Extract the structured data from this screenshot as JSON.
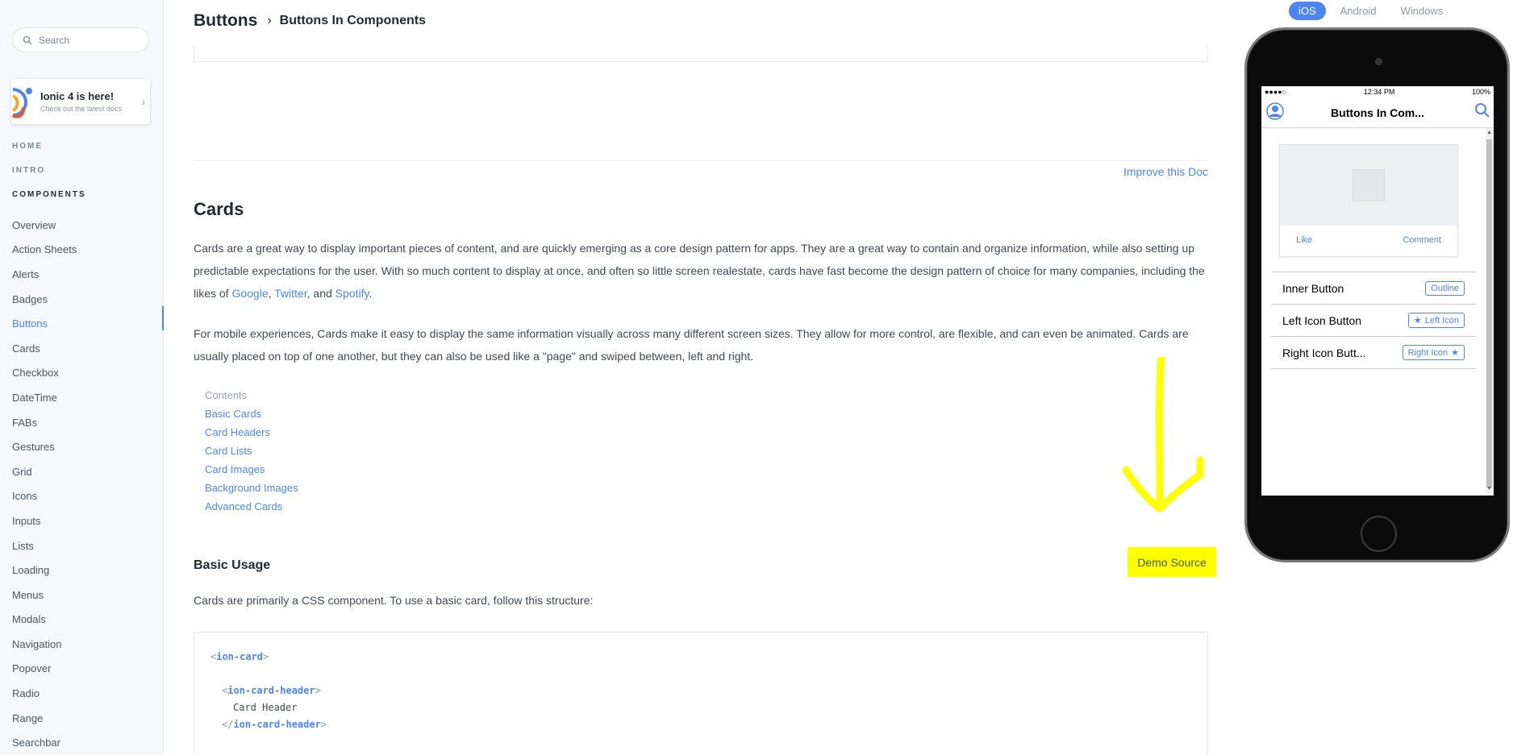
{
  "sidebar": {
    "search_placeholder": "Search",
    "promo": {
      "title": "Ionic 4 is here!",
      "subtitle": "Check out the latest docs"
    },
    "sections": {
      "home": "HOME",
      "intro": "INTRO",
      "components": "COMPONENTS"
    },
    "items": [
      {
        "label": "Overview"
      },
      {
        "label": "Action Sheets"
      },
      {
        "label": "Alerts"
      },
      {
        "label": "Badges"
      },
      {
        "label": "Buttons",
        "active": true
      },
      {
        "label": "Cards"
      },
      {
        "label": "Checkbox"
      },
      {
        "label": "DateTime"
      },
      {
        "label": "FABs"
      },
      {
        "label": "Gestures"
      },
      {
        "label": "Grid"
      },
      {
        "label": "Icons"
      },
      {
        "label": "Inputs"
      },
      {
        "label": "Lists"
      },
      {
        "label": "Loading"
      },
      {
        "label": "Menus"
      },
      {
        "label": "Modals"
      },
      {
        "label": "Navigation"
      },
      {
        "label": "Popover"
      },
      {
        "label": "Radio"
      },
      {
        "label": "Range"
      },
      {
        "label": "Searchbar"
      }
    ]
  },
  "header": {
    "title": "Buttons",
    "sub": "Buttons In Components"
  },
  "main": {
    "improve_link": "Improve this Doc",
    "heading": "Cards",
    "para1": {
      "before": "Cards are a great way to display important pieces of content, and are quickly emerging as a core design pattern for apps. They are a great way to contain and organize information, while also setting up predictable expectations for the user. With so much content to display at once, and often so little screen realestate, cards have fast become the design pattern of choice for many companies, including the likes of ",
      "link1": "Google",
      "sep1": ", ",
      "link2": "Twitter",
      "sep2": ", and ",
      "link3": "Spotify",
      "end": "."
    },
    "para2": "For mobile experiences, Cards make it easy to display the same information visually across many different screen sizes. They allow for more control, are flexible, and can even be animated. Cards are usually placed on top of one another, but they can also be used like a \"page\" and swiped between, left and right.",
    "contents_label": "Contents",
    "contents": [
      "Basic Cards",
      "Card Headers",
      "Card Lists",
      "Card Images",
      "Background Images",
      "Advanced Cards"
    ],
    "basic_usage": "Basic Usage",
    "demo_source": "Demo Source",
    "basic_text": "Cards are primarily a CSS component. To use a basic card, follow this structure:",
    "code": {
      "lt": "<",
      "gt": ">",
      "close_lt": "</",
      "tag_card": "ion-card",
      "tag_header": "ion-card-header",
      "header_text": "Card Header"
    }
  },
  "platforms": [
    "iOS",
    "Android",
    "Windows"
  ],
  "active_platform": "iOS",
  "phone": {
    "status": {
      "signal": "●●●●○",
      "time": "12:34 PM",
      "battery": "100%"
    },
    "title": "Buttons In Com...",
    "card_actions": {
      "like": "Like",
      "comment": "Comment"
    },
    "list": [
      {
        "label": "Inner Button",
        "button": "Outline",
        "icon": ""
      },
      {
        "label": "Left Icon Button",
        "button": "Left Icon",
        "icon": "star-left"
      },
      {
        "label": "Right Icon Butt...",
        "button": "Right Icon",
        "icon": "star-right"
      }
    ]
  },
  "colors": {
    "accent": "#4d86f0",
    "highlight": "#ffff00"
  }
}
